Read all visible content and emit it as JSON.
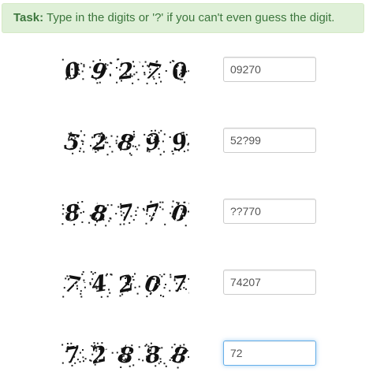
{
  "task": {
    "label": "Task:",
    "text": "Type in the digits or '?' if you can't even guess the digit."
  },
  "rows": [
    {
      "digits": [
        "0",
        "9",
        "2",
        "7",
        "0"
      ],
      "answer": "09270"
    },
    {
      "digits": [
        "5",
        "2",
        "?",
        "9",
        "9"
      ],
      "answer": "52?99"
    },
    {
      "digits": [
        "?",
        "?",
        "7",
        "7",
        "0"
      ],
      "answer": "??770"
    },
    {
      "digits": [
        "7",
        "4",
        "2",
        "0",
        "7"
      ],
      "answer": "74207"
    },
    {
      "digits": [
        "7",
        "2",
        "?",
        "?",
        "?"
      ],
      "answer": "72"
    }
  ],
  "colors": {
    "banner_bg": "#dff0d8",
    "banner_text": "#3c763d",
    "focus_border": "#66afe9"
  }
}
